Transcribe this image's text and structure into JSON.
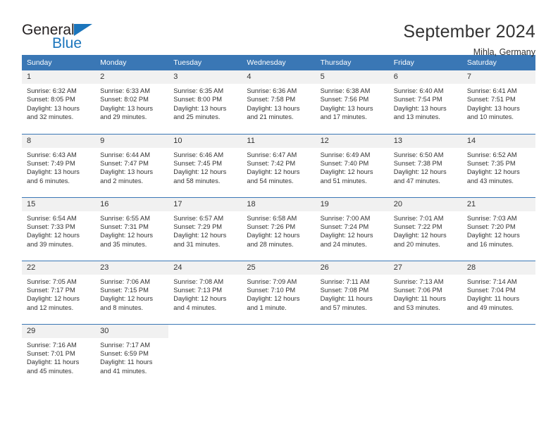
{
  "brand": {
    "name_part1": "General",
    "name_part2": "Blue",
    "logo_icon": "triangle-flag-icon"
  },
  "header": {
    "title": "September 2024",
    "location": "Mihla, Germany"
  },
  "colors": {
    "header_blue": "#3a77b5",
    "brand_blue": "#1b75bc",
    "daynum_band": "#f1f1f1",
    "text": "#333333"
  },
  "calendar": {
    "weekday_headers": [
      "Sunday",
      "Monday",
      "Tuesday",
      "Wednesday",
      "Thursday",
      "Friday",
      "Saturday"
    ],
    "weeks": [
      [
        {
          "day": "1",
          "info": "Sunrise: 6:32 AM\nSunset: 8:05 PM\nDaylight: 13 hours\nand 32 minutes."
        },
        {
          "day": "2",
          "info": "Sunrise: 6:33 AM\nSunset: 8:02 PM\nDaylight: 13 hours\nand 29 minutes."
        },
        {
          "day": "3",
          "info": "Sunrise: 6:35 AM\nSunset: 8:00 PM\nDaylight: 13 hours\nand 25 minutes."
        },
        {
          "day": "4",
          "info": "Sunrise: 6:36 AM\nSunset: 7:58 PM\nDaylight: 13 hours\nand 21 minutes."
        },
        {
          "day": "5",
          "info": "Sunrise: 6:38 AM\nSunset: 7:56 PM\nDaylight: 13 hours\nand 17 minutes."
        },
        {
          "day": "6",
          "info": "Sunrise: 6:40 AM\nSunset: 7:54 PM\nDaylight: 13 hours\nand 13 minutes."
        },
        {
          "day": "7",
          "info": "Sunrise: 6:41 AM\nSunset: 7:51 PM\nDaylight: 13 hours\nand 10 minutes."
        }
      ],
      [
        {
          "day": "8",
          "info": "Sunrise: 6:43 AM\nSunset: 7:49 PM\nDaylight: 13 hours\nand 6 minutes."
        },
        {
          "day": "9",
          "info": "Sunrise: 6:44 AM\nSunset: 7:47 PM\nDaylight: 13 hours\nand 2 minutes."
        },
        {
          "day": "10",
          "info": "Sunrise: 6:46 AM\nSunset: 7:45 PM\nDaylight: 12 hours\nand 58 minutes."
        },
        {
          "day": "11",
          "info": "Sunrise: 6:47 AM\nSunset: 7:42 PM\nDaylight: 12 hours\nand 54 minutes."
        },
        {
          "day": "12",
          "info": "Sunrise: 6:49 AM\nSunset: 7:40 PM\nDaylight: 12 hours\nand 51 minutes."
        },
        {
          "day": "13",
          "info": "Sunrise: 6:50 AM\nSunset: 7:38 PM\nDaylight: 12 hours\nand 47 minutes."
        },
        {
          "day": "14",
          "info": "Sunrise: 6:52 AM\nSunset: 7:35 PM\nDaylight: 12 hours\nand 43 minutes."
        }
      ],
      [
        {
          "day": "15",
          "info": "Sunrise: 6:54 AM\nSunset: 7:33 PM\nDaylight: 12 hours\nand 39 minutes."
        },
        {
          "day": "16",
          "info": "Sunrise: 6:55 AM\nSunset: 7:31 PM\nDaylight: 12 hours\nand 35 minutes."
        },
        {
          "day": "17",
          "info": "Sunrise: 6:57 AM\nSunset: 7:29 PM\nDaylight: 12 hours\nand 31 minutes."
        },
        {
          "day": "18",
          "info": "Sunrise: 6:58 AM\nSunset: 7:26 PM\nDaylight: 12 hours\nand 28 minutes."
        },
        {
          "day": "19",
          "info": "Sunrise: 7:00 AM\nSunset: 7:24 PM\nDaylight: 12 hours\nand 24 minutes."
        },
        {
          "day": "20",
          "info": "Sunrise: 7:01 AM\nSunset: 7:22 PM\nDaylight: 12 hours\nand 20 minutes."
        },
        {
          "day": "21",
          "info": "Sunrise: 7:03 AM\nSunset: 7:20 PM\nDaylight: 12 hours\nand 16 minutes."
        }
      ],
      [
        {
          "day": "22",
          "info": "Sunrise: 7:05 AM\nSunset: 7:17 PM\nDaylight: 12 hours\nand 12 minutes."
        },
        {
          "day": "23",
          "info": "Sunrise: 7:06 AM\nSunset: 7:15 PM\nDaylight: 12 hours\nand 8 minutes."
        },
        {
          "day": "24",
          "info": "Sunrise: 7:08 AM\nSunset: 7:13 PM\nDaylight: 12 hours\nand 4 minutes."
        },
        {
          "day": "25",
          "info": "Sunrise: 7:09 AM\nSunset: 7:10 PM\nDaylight: 12 hours\nand 1 minute."
        },
        {
          "day": "26",
          "info": "Sunrise: 7:11 AM\nSunset: 7:08 PM\nDaylight: 11 hours\nand 57 minutes."
        },
        {
          "day": "27",
          "info": "Sunrise: 7:13 AM\nSunset: 7:06 PM\nDaylight: 11 hours\nand 53 minutes."
        },
        {
          "day": "28",
          "info": "Sunrise: 7:14 AM\nSunset: 7:04 PM\nDaylight: 11 hours\nand 49 minutes."
        }
      ],
      [
        {
          "day": "29",
          "info": "Sunrise: 7:16 AM\nSunset: 7:01 PM\nDaylight: 11 hours\nand 45 minutes."
        },
        {
          "day": "30",
          "info": "Sunrise: 7:17 AM\nSunset: 6:59 PM\nDaylight: 11 hours\nand 41 minutes."
        },
        {
          "day": "",
          "info": ""
        },
        {
          "day": "",
          "info": ""
        },
        {
          "day": "",
          "info": ""
        },
        {
          "day": "",
          "info": ""
        },
        {
          "day": "",
          "info": ""
        }
      ]
    ]
  }
}
